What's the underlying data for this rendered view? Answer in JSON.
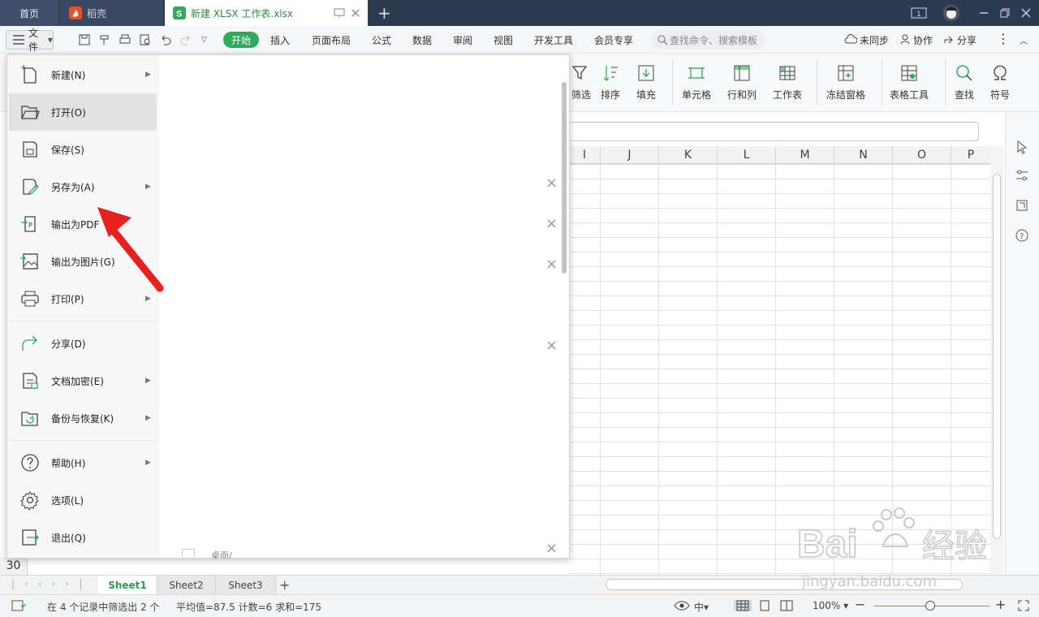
{
  "titlebar": {
    "home": "首页",
    "daoke": "稻壳",
    "file_tab": "新建 XLSX 工作表.xlsx",
    "new_tab": "+"
  },
  "menubar": {
    "file": "文件",
    "start": "开始",
    "tabs": [
      "插入",
      "页面布局",
      "公式",
      "数据",
      "审阅",
      "视图",
      "开发工具",
      "会员专享"
    ],
    "search_placeholder": "查找命令、搜索模板",
    "sync": "未同步",
    "collab": "协作",
    "share": "分享"
  },
  "ribbon": {
    "items": [
      "筛选",
      "排序",
      "填充",
      "单元格",
      "行和列",
      "工作表",
      "冻结窗格",
      "表格工具",
      "查找",
      "符号"
    ]
  },
  "grid": {
    "columns": [
      "I",
      "J",
      "K",
      "L",
      "M",
      "N",
      "O",
      "P"
    ],
    "row_label": "30"
  },
  "file_menu": {
    "items": [
      {
        "label": "新建(N)",
        "icon": "new-file-icon",
        "arrow": true
      },
      {
        "label": "打开(O)",
        "icon": "folder-open-icon",
        "arrow": false
      },
      {
        "label": "保存(S)",
        "icon": "save-icon",
        "arrow": false
      },
      {
        "label": "另存为(A)",
        "icon": "save-as-icon",
        "arrow": true
      },
      {
        "label": "输出为PDF",
        "icon": "export-pdf-icon",
        "arrow": false
      },
      {
        "label": "输出为图片(G)",
        "icon": "export-image-icon",
        "arrow": false
      },
      {
        "label": "打印(P)",
        "icon": "print-icon",
        "arrow": true
      },
      {
        "label": "分享(D)",
        "icon": "share-icon",
        "arrow": false
      },
      {
        "label": "文档加密(E)",
        "icon": "encrypt-icon",
        "arrow": true
      },
      {
        "label": "备份与恢复(K)",
        "icon": "backup-icon",
        "arrow": true
      },
      {
        "label": "帮助(H)",
        "icon": "help-icon",
        "arrow": true
      },
      {
        "label": "选项(L)",
        "icon": "gear-icon",
        "arrow": false
      },
      {
        "label": "退出(Q)",
        "icon": "exit-icon",
        "arrow": false
      }
    ],
    "recent_path": "桌面/"
  },
  "sheets": [
    "Sheet1",
    "Sheet2",
    "Sheet3"
  ],
  "status": {
    "filter": "在 4 个记录中筛选出 2 个",
    "stats": "平均值=87.5  计数=6  求和=175",
    "zoom": "100%"
  },
  "watermark": {
    "logo": "Bai du 经验",
    "url": "jingyan.baidu.com"
  },
  "colors": {
    "accent": "#2faa5a",
    "titlebar": "#2d3b52",
    "arrow": "#e8201f"
  },
  "zoom_level": 1.0
}
